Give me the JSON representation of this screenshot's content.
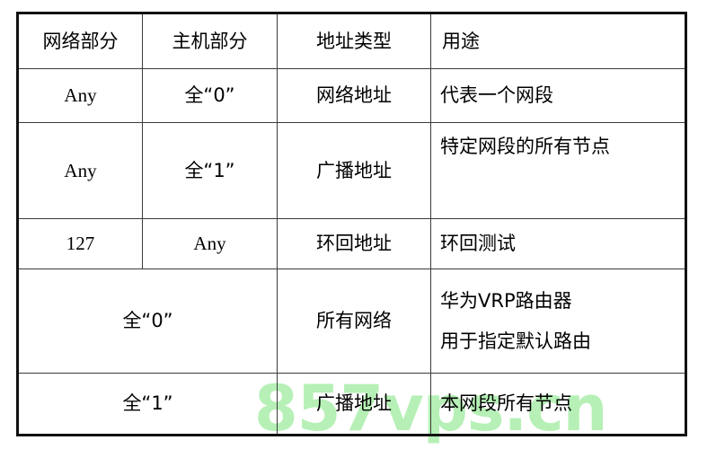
{
  "document": {
    "type": "table",
    "watermark": "857vps.cn",
    "watermark_color": "#b6f0b6",
    "header_bg_color": "#e4e4e4",
    "border_color": "#3b3b3b"
  },
  "table": {
    "columns": [
      {
        "key": "network_part",
        "label": "网络部分",
        "align": "center"
      },
      {
        "key": "host_part",
        "label": "主机部分",
        "align": "center"
      },
      {
        "key": "address_type",
        "label": "地址类型",
        "align": "center"
      },
      {
        "key": "purpose",
        "label": "用途",
        "align": "left"
      }
    ],
    "rows": [
      {
        "network_part": "Any",
        "host_part": "全“0”",
        "address_type": "网络地址",
        "purpose": "代表一个网段"
      },
      {
        "network_part": "Any",
        "host_part": "全“1”",
        "address_type": "广播地址",
        "purpose": "特定网段的所有节点"
      },
      {
        "network_part": "127",
        "host_part": "Any",
        "address_type": "环回地址",
        "purpose": "环回测试"
      },
      {
        "merged_network_host": "全“0”",
        "address_type": "所有网络",
        "purpose_line1": "华为VRP路由器",
        "purpose_line2": "用于指定默认路由"
      },
      {
        "merged_network_host": "全“1”",
        "address_type": "广播地址",
        "purpose": "本网段所有节点"
      }
    ]
  }
}
